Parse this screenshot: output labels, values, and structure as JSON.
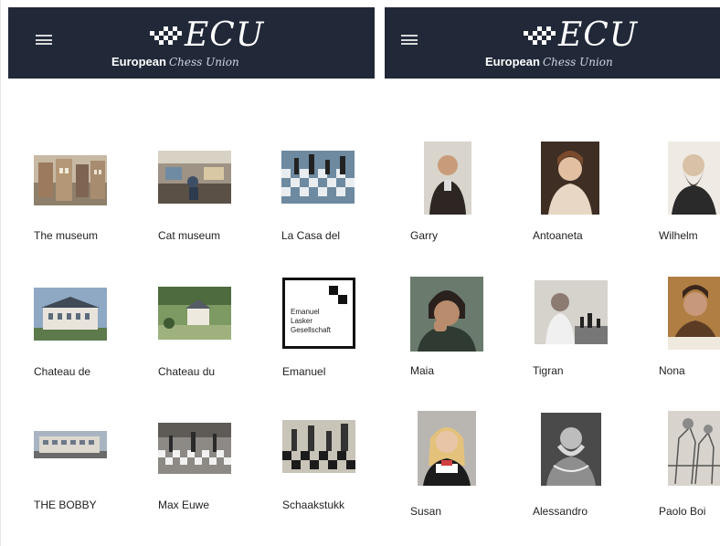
{
  "header": {
    "logo_mark_text": "ECU",
    "logo_primary": "European",
    "logo_secondary": "Chess Union",
    "menu_icon": "hamburger-icon",
    "bg_color": "#212838"
  },
  "places": [
    {
      "label": "The museum"
    },
    {
      "label": "Cat museum"
    },
    {
      "label": "La Casa del"
    },
    {
      "label": "Chateau de"
    },
    {
      "label": "Chateau du"
    },
    {
      "label": "Emanuel"
    },
    {
      "label": "THE BOBBY"
    },
    {
      "label": "Max Euwe"
    },
    {
      "label": "Schaakstukk"
    }
  ],
  "emanuel_logo_text": [
    "Emanuel",
    "Lasker",
    "Gesellschaft"
  ],
  "players": [
    {
      "label": "Garry"
    },
    {
      "label": "Antoaneta"
    },
    {
      "label": "Wilhelm"
    },
    {
      "label": "Maia"
    },
    {
      "label": "Tigran"
    },
    {
      "label": "Nona"
    },
    {
      "label": "Susan"
    },
    {
      "label": "Alessandro"
    },
    {
      "label": "Paolo Boi"
    }
  ]
}
